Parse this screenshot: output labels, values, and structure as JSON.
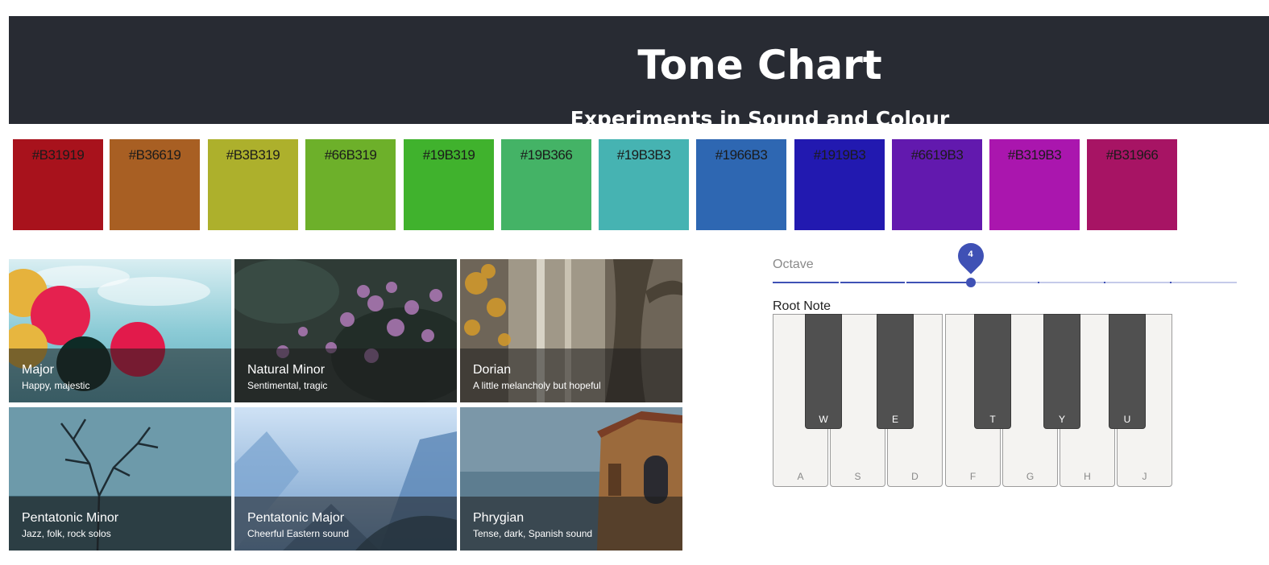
{
  "header": {
    "title": "Tone Chart",
    "subtitle": "Experiments in Sound and Colour"
  },
  "swatches": [
    {
      "label": "#B31919",
      "color": "#a8121c"
    },
    {
      "label": "#B36619",
      "color": "#a85f23"
    },
    {
      "label": "#B3B319",
      "color": "#adb02c"
    },
    {
      "label": "#66B319",
      "color": "#6db02a"
    },
    {
      "label": "#19B319",
      "color": "#40b22d"
    },
    {
      "label": "#19B366",
      "color": "#44b366"
    },
    {
      "label": "#19B3B3",
      "color": "#46b3b2"
    },
    {
      "label": "#1966B3",
      "color": "#2e67b2"
    },
    {
      "label": "#1919B3",
      "color": "#2219b0"
    },
    {
      "label": "#6619B3",
      "color": "#6219ae"
    },
    {
      "label": "#B319B3",
      "color": "#aa16ae"
    },
    {
      "label": "#B31966",
      "color": "#a71464"
    }
  ],
  "scales": [
    {
      "name": "Major",
      "desc": "Happy, majestic"
    },
    {
      "name": "Natural Minor",
      "desc": "Sentimental, tragic"
    },
    {
      "name": "Dorian",
      "desc": "A little melancholy but hopeful"
    },
    {
      "name": "Pentatonic Minor",
      "desc": "Jazz, folk, rock solos"
    },
    {
      "name": "Pentatonic Major",
      "desc": "Cheerful Eastern sound"
    },
    {
      "name": "Phrygian",
      "desc": "Tense, dark, Spanish sound"
    }
  ],
  "octave": {
    "label": "Octave",
    "value": 4,
    "value_text": "4",
    "min": 1,
    "max": 8,
    "accent": "#3f51b5"
  },
  "root_note": {
    "label": "Root Note",
    "white_keys": [
      "A",
      "S",
      "D",
      "F",
      "G",
      "H",
      "J"
    ],
    "black_keys": [
      "W",
      "E",
      "T",
      "Y",
      "U"
    ]
  }
}
